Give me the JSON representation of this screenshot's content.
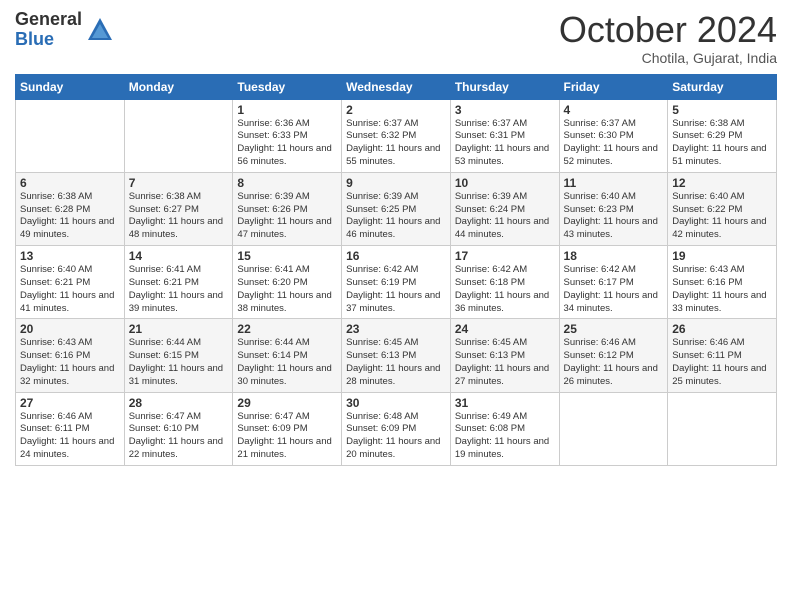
{
  "logo": {
    "general": "General",
    "blue": "Blue"
  },
  "header": {
    "month": "October 2024",
    "location": "Chotila, Gujarat, India"
  },
  "days_of_week": [
    "Sunday",
    "Monday",
    "Tuesday",
    "Wednesday",
    "Thursday",
    "Friday",
    "Saturday"
  ],
  "weeks": [
    [
      {
        "day": "",
        "detail": ""
      },
      {
        "day": "",
        "detail": ""
      },
      {
        "day": "1",
        "detail": "Sunrise: 6:36 AM\nSunset: 6:33 PM\nDaylight: 11 hours and 56 minutes."
      },
      {
        "day": "2",
        "detail": "Sunrise: 6:37 AM\nSunset: 6:32 PM\nDaylight: 11 hours and 55 minutes."
      },
      {
        "day": "3",
        "detail": "Sunrise: 6:37 AM\nSunset: 6:31 PM\nDaylight: 11 hours and 53 minutes."
      },
      {
        "day": "4",
        "detail": "Sunrise: 6:37 AM\nSunset: 6:30 PM\nDaylight: 11 hours and 52 minutes."
      },
      {
        "day": "5",
        "detail": "Sunrise: 6:38 AM\nSunset: 6:29 PM\nDaylight: 11 hours and 51 minutes."
      }
    ],
    [
      {
        "day": "6",
        "detail": "Sunrise: 6:38 AM\nSunset: 6:28 PM\nDaylight: 11 hours and 49 minutes."
      },
      {
        "day": "7",
        "detail": "Sunrise: 6:38 AM\nSunset: 6:27 PM\nDaylight: 11 hours and 48 minutes."
      },
      {
        "day": "8",
        "detail": "Sunrise: 6:39 AM\nSunset: 6:26 PM\nDaylight: 11 hours and 47 minutes."
      },
      {
        "day": "9",
        "detail": "Sunrise: 6:39 AM\nSunset: 6:25 PM\nDaylight: 11 hours and 46 minutes."
      },
      {
        "day": "10",
        "detail": "Sunrise: 6:39 AM\nSunset: 6:24 PM\nDaylight: 11 hours and 44 minutes."
      },
      {
        "day": "11",
        "detail": "Sunrise: 6:40 AM\nSunset: 6:23 PM\nDaylight: 11 hours and 43 minutes."
      },
      {
        "day": "12",
        "detail": "Sunrise: 6:40 AM\nSunset: 6:22 PM\nDaylight: 11 hours and 42 minutes."
      }
    ],
    [
      {
        "day": "13",
        "detail": "Sunrise: 6:40 AM\nSunset: 6:21 PM\nDaylight: 11 hours and 41 minutes."
      },
      {
        "day": "14",
        "detail": "Sunrise: 6:41 AM\nSunset: 6:21 PM\nDaylight: 11 hours and 39 minutes."
      },
      {
        "day": "15",
        "detail": "Sunrise: 6:41 AM\nSunset: 6:20 PM\nDaylight: 11 hours and 38 minutes."
      },
      {
        "day": "16",
        "detail": "Sunrise: 6:42 AM\nSunset: 6:19 PM\nDaylight: 11 hours and 37 minutes."
      },
      {
        "day": "17",
        "detail": "Sunrise: 6:42 AM\nSunset: 6:18 PM\nDaylight: 11 hours and 36 minutes."
      },
      {
        "day": "18",
        "detail": "Sunrise: 6:42 AM\nSunset: 6:17 PM\nDaylight: 11 hours and 34 minutes."
      },
      {
        "day": "19",
        "detail": "Sunrise: 6:43 AM\nSunset: 6:16 PM\nDaylight: 11 hours and 33 minutes."
      }
    ],
    [
      {
        "day": "20",
        "detail": "Sunrise: 6:43 AM\nSunset: 6:16 PM\nDaylight: 11 hours and 32 minutes."
      },
      {
        "day": "21",
        "detail": "Sunrise: 6:44 AM\nSunset: 6:15 PM\nDaylight: 11 hours and 31 minutes."
      },
      {
        "day": "22",
        "detail": "Sunrise: 6:44 AM\nSunset: 6:14 PM\nDaylight: 11 hours and 30 minutes."
      },
      {
        "day": "23",
        "detail": "Sunrise: 6:45 AM\nSunset: 6:13 PM\nDaylight: 11 hours and 28 minutes."
      },
      {
        "day": "24",
        "detail": "Sunrise: 6:45 AM\nSunset: 6:13 PM\nDaylight: 11 hours and 27 minutes."
      },
      {
        "day": "25",
        "detail": "Sunrise: 6:46 AM\nSunset: 6:12 PM\nDaylight: 11 hours and 26 minutes."
      },
      {
        "day": "26",
        "detail": "Sunrise: 6:46 AM\nSunset: 6:11 PM\nDaylight: 11 hours and 25 minutes."
      }
    ],
    [
      {
        "day": "27",
        "detail": "Sunrise: 6:46 AM\nSunset: 6:11 PM\nDaylight: 11 hours and 24 minutes."
      },
      {
        "day": "28",
        "detail": "Sunrise: 6:47 AM\nSunset: 6:10 PM\nDaylight: 11 hours and 22 minutes."
      },
      {
        "day": "29",
        "detail": "Sunrise: 6:47 AM\nSunset: 6:09 PM\nDaylight: 11 hours and 21 minutes."
      },
      {
        "day": "30",
        "detail": "Sunrise: 6:48 AM\nSunset: 6:09 PM\nDaylight: 11 hours and 20 minutes."
      },
      {
        "day": "31",
        "detail": "Sunrise: 6:49 AM\nSunset: 6:08 PM\nDaylight: 11 hours and 19 minutes."
      },
      {
        "day": "",
        "detail": ""
      },
      {
        "day": "",
        "detail": ""
      }
    ]
  ]
}
